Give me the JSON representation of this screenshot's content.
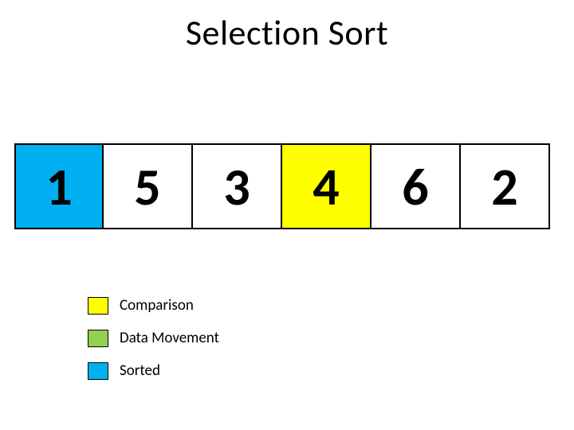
{
  "title": "Selection Sort",
  "cells": [
    {
      "value": "1",
      "state": "sorted"
    },
    {
      "value": "5",
      "state": "plain"
    },
    {
      "value": "3",
      "state": "plain"
    },
    {
      "value": "4",
      "state": "comparison"
    },
    {
      "value": "6",
      "state": "plain"
    },
    {
      "value": "2",
      "state": "plain"
    }
  ],
  "legend": {
    "comparison": "Comparison",
    "movement": "Data Movement",
    "sorted": "Sorted"
  },
  "colors": {
    "comparison": "#ffff00",
    "movement": "#92d050",
    "sorted": "#00b0f0"
  }
}
